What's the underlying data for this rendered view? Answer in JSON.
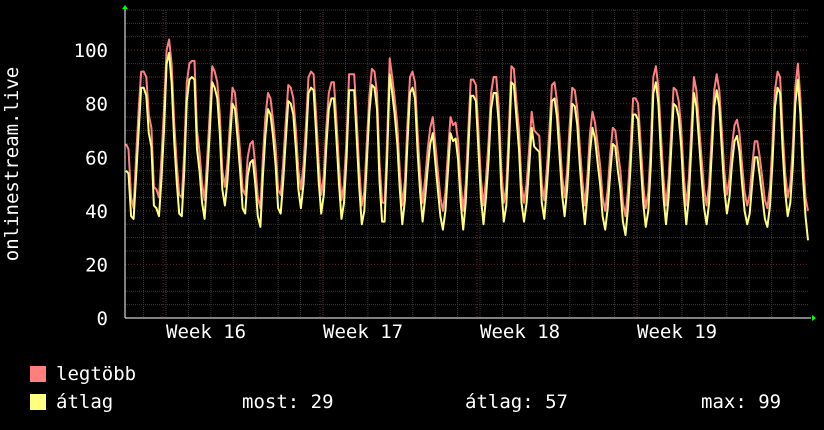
{
  "chart_data": {
    "type": "line",
    "ylabel": "onlinestream.live",
    "ylim": [
      0,
      115
    ],
    "yticks": [
      0,
      20,
      40,
      60,
      80,
      100
    ],
    "grid": true,
    "x_ticks": [
      "Week 16",
      "Week 17",
      "Week 18",
      "Week 19"
    ],
    "series": [
      {
        "name": "legtöbb",
        "color": "#ff7f7f",
        "values": [
          65,
          63,
          45,
          41,
          60,
          78,
          92,
          92,
          90,
          76,
          71,
          49,
          48,
          45,
          60,
          78,
          100,
          104,
          95,
          73,
          58,
          46,
          45,
          62,
          88,
          95,
          96,
          96,
          70,
          62,
          50,
          44,
          59,
          76,
          94,
          92,
          88,
          76,
          55,
          49,
          58,
          72,
          86,
          84,
          73,
          62,
          48,
          46,
          60,
          65,
          66,
          57,
          45,
          41,
          60,
          75,
          84,
          82,
          74,
          64,
          48,
          46,
          58,
          73,
          87,
          86,
          82,
          70,
          55,
          48,
          57,
          72,
          90,
          92,
          91,
          76,
          58,
          46,
          53,
          71,
          84,
          88,
          88,
          74,
          57,
          44,
          50,
          67,
          91,
          91,
          91,
          74,
          56,
          42,
          47,
          66,
          83,
          93,
          92,
          84,
          58,
          43,
          43,
          66,
          97,
          90,
          82,
          72,
          55,
          42,
          51,
          72,
          90,
          92,
          88,
          69,
          54,
          43,
          52,
          63,
          71,
          75,
          65,
          55,
          45,
          40,
          47,
          62,
          75,
          72,
          73,
          66,
          50,
          40,
          50,
          70,
          89,
          89,
          87,
          70,
          52,
          42,
          52,
          66,
          84,
          90,
          90,
          79,
          56,
          43,
          49,
          70,
          94,
          93,
          81,
          70,
          50,
          43,
          50,
          63,
          77,
          70,
          69,
          68,
          50,
          44,
          56,
          70,
          87,
          88,
          81,
          68,
          53,
          45,
          55,
          72,
          86,
          85,
          78,
          64,
          51,
          42,
          53,
          69,
          77,
          73,
          65,
          57,
          45,
          40,
          48,
          61,
          71,
          70,
          62,
          55,
          43,
          38,
          48,
          63,
          82,
          82,
          80,
          65,
          50,
          41,
          47,
          64,
          90,
          94,
          86,
          68,
          52,
          42,
          52,
          69,
          86,
          85,
          81,
          71,
          53,
          42,
          52,
          71,
          90,
          85,
          72,
          60,
          48,
          42,
          50,
          68,
          85,
          91,
          85,
          70,
          55,
          46,
          52,
          64,
          72,
          74,
          69,
          57,
          47,
          42,
          46,
          57,
          66,
          66,
          60,
          52,
          44,
          41,
          49,
          65,
          85,
          92,
          90,
          70,
          54,
          45,
          50,
          64,
          86,
          95,
          82,
          60,
          45,
          40
        ]
      },
      {
        "name": "átlag",
        "color": "#ffff80",
        "values": [
          55,
          54,
          38,
          37,
          53,
          70,
          86,
          86,
          83,
          69,
          64,
          42,
          41,
          38,
          52,
          70,
          95,
          99,
          88,
          66,
          51,
          39,
          38,
          55,
          81,
          89,
          90,
          89,
          63,
          55,
          43,
          37,
          52,
          69,
          88,
          86,
          82,
          69,
          48,
          42,
          51,
          66,
          80,
          78,
          67,
          55,
          41,
          39,
          53,
          58,
          59,
          50,
          38,
          34,
          53,
          68,
          78,
          76,
          68,
          57,
          41,
          39,
          51,
          66,
          81,
          80,
          76,
          63,
          48,
          41,
          50,
          65,
          84,
          86,
          85,
          69,
          51,
          39,
          46,
          64,
          78,
          82,
          82,
          67,
          50,
          37,
          43,
          60,
          85,
          85,
          85,
          67,
          49,
          35,
          40,
          59,
          77,
          87,
          86,
          78,
          51,
          36,
          36,
          59,
          91,
          84,
          76,
          65,
          48,
          35,
          44,
          65,
          84,
          86,
          82,
          62,
          47,
          36,
          45,
          56,
          65,
          69,
          58,
          48,
          38,
          33,
          40,
          55,
          69,
          66,
          67,
          59,
          43,
          33,
          43,
          63,
          83,
          83,
          81,
          63,
          45,
          35,
          45,
          59,
          78,
          84,
          84,
          73,
          49,
          36,
          42,
          63,
          88,
          87,
          75,
          63,
          43,
          36,
          43,
          56,
          71,
          64,
          63,
          62,
          43,
          37,
          49,
          63,
          81,
          82,
          75,
          61,
          46,
          38,
          48,
          65,
          80,
          79,
          72,
          57,
          44,
          35,
          46,
          62,
          71,
          67,
          58,
          50,
          38,
          33,
          41,
          54,
          65,
          64,
          55,
          48,
          36,
          31,
          41,
          56,
          76,
          76,
          74,
          58,
          43,
          34,
          40,
          57,
          84,
          88,
          80,
          61,
          45,
          35,
          45,
          62,
          80,
          79,
          75,
          64,
          46,
          35,
          45,
          64,
          84,
          79,
          66,
          53,
          41,
          35,
          43,
          61,
          79,
          85,
          79,
          63,
          48,
          39,
          45,
          57,
          66,
          68,
          62,
          50,
          40,
          35,
          39,
          50,
          60,
          60,
          53,
          45,
          37,
          34,
          42,
          58,
          79,
          86,
          84,
          63,
          47,
          38,
          43,
          57,
          80,
          89,
          76,
          53,
          38,
          29
        ]
      }
    ]
  },
  "legend": {
    "max_label": "legtöbb",
    "avg_label": "átlag",
    "stat_now": "most: 29",
    "stat_avg": "átlag: 57",
    "stat_max": "max: 99"
  }
}
